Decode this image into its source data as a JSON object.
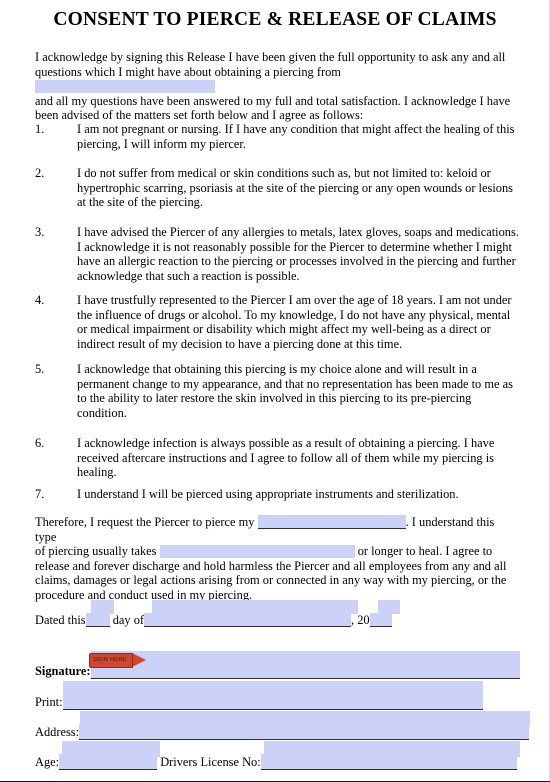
{
  "document": {
    "title": "CONSENT TO PIERCE & RELEASE OF CLAIMS",
    "intro": {
      "before_blank": "I acknowledge by signing this Release I have been given the full opportunity to ask any and all questions which I might have about obtaining a piercing from",
      "after_blank": "and all my questions have been answered to my full and total satisfaction.  I acknowledge I have been advised of the matters set forth below and I agree as follows:"
    },
    "clauses": [
      {
        "number": "1.",
        "text": "I am not pregnant or nursing.  If I have any condition that might affect the healing of this piercing, I will inform my piercer."
      },
      {
        "number": "2.",
        "text": "I do not suffer from medical or skin conditions such as, but not limited to: keloid or hypertrophic scarring, psoriasis at the site of the piercing or any open wounds or lesions at the site of the piercing."
      },
      {
        "number": "3.",
        "text": "I have advised the Piercer of any allergies to metals, latex gloves, soaps and medications.  I acknowledge it is not reasonably possible for the Piercer to determine whether I might have an allergic reaction to the piercing or processes involved in the piercing and further acknowledge that such a reaction is possible."
      },
      {
        "number": "4.",
        "text": "I have trustfully represented to the Piercer I am over the age of 18 years.  I am not under the influence of drugs or alcohol.   To my knowledge, I do not have any physical, mental or medical impairment or disability which might affect my well-being as a direct or indirect result of my decision to have a piercing done at this time."
      },
      {
        "number": "5.",
        "text": "I acknowledge that obtaining this piercing is my choice alone and will result in a permanent change to my appearance, and that no representation has been made to me as to the ability to later restore the skin involved in this piercing to its pre-piercing condition."
      },
      {
        "number": "6.",
        "text": "I acknowledge infection is always possible as a result of obtaining a piercing. I have received aftercare instructions and I agree to follow all of them while my piercing is healing."
      },
      {
        "number": "7.",
        "text": "I understand I will be pierced using appropriate instruments and sterilization."
      }
    ],
    "therefore": {
      "part1": "Therefore, I request the Piercer to pierce my",
      "part2": ".  I understand this type",
      "part3": "of piercing usually takes",
      "part4": "or longer to heal. I agree to",
      "part5": "release and forever discharge and hold harmless the Piercer and all employees from any and all claims, damages or legal actions arising from or connected in any way with my piercing, or the procedure and conduct used in my piercing."
    },
    "date_line": {
      "prefix": "Dated this",
      "middle": "day of",
      "comma_year": ", 20"
    },
    "signature_block": {
      "signature_label": "Signature:",
      "print_label": "Print:",
      "address_label": "Address:",
      "age_label": "Age:",
      "drivers_license_label": "Drivers License No:"
    },
    "sign_tag": {
      "label": "SIGN HERE"
    }
  },
  "colors": {
    "highlight_fill": "#ccd1f7",
    "rule": "#2b2b3d",
    "sign_tag": "#d0452c",
    "text": "#000000"
  }
}
